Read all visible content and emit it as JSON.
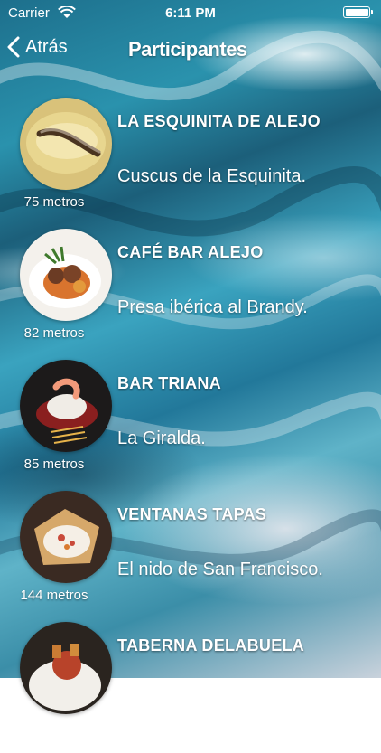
{
  "status_bar": {
    "carrier": "Carrier",
    "time": "6:11 PM"
  },
  "nav": {
    "back_label": "Atrás",
    "title": "Participantes"
  },
  "participants": [
    {
      "name": "LA ESQUINITA DE ALEJO",
      "dish": "Cuscus de la Esquinita.",
      "distance": "75 metros"
    },
    {
      "name": "CAFÉ BAR ALEJO",
      "dish": "Presa ibérica al Brandy.",
      "distance": "82 metros"
    },
    {
      "name": "BAR TRIANA",
      "dish": "La Giralda.",
      "distance": "85 metros"
    },
    {
      "name": "VENTANAS TAPAS",
      "dish": "El nido de San Francisco.",
      "distance": "144 metros"
    },
    {
      "name": "TABERNA DELABUELA",
      "dish": "",
      "distance": ""
    }
  ]
}
